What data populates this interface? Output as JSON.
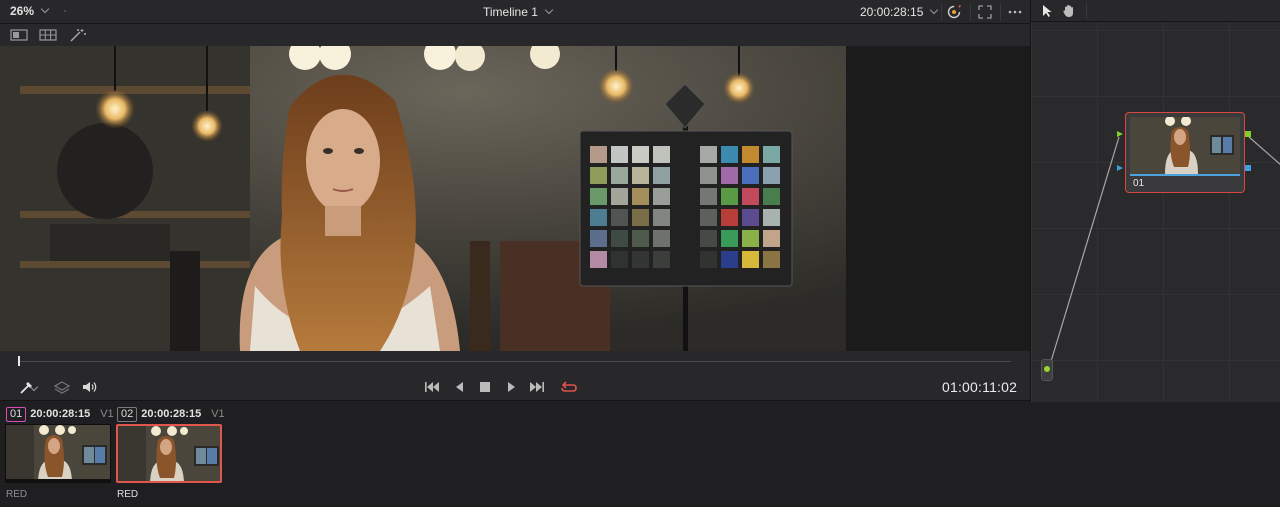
{
  "viewer": {
    "zoom_label": "26%",
    "timeline_title": "Timeline 1",
    "source_timecode": "20:00:28:15",
    "current_timecode": "01:00:11:02"
  },
  "clips": [
    {
      "number": "01",
      "timecode": "20:00:28:15",
      "track": "V1",
      "label": "RED",
      "selected": false
    },
    {
      "number": "02",
      "timecode": "20:00:28:15",
      "track": "V1",
      "label": "RED",
      "selected": true
    }
  ],
  "nodes": {
    "main_label": "01"
  },
  "colors": {
    "accent_red": "#e0574d",
    "loop_red": "#e0524a",
    "node_bar_blue": "#4aa3df",
    "port_green": "#7fd12a",
    "clip_badge_pink": "#d54fb5"
  },
  "icons": {
    "topbar": [
      "chevron-down-icon",
      "highlight-icon",
      "fullscreen-icon",
      "more-options-icon"
    ],
    "subbar": [
      "single-viewer-icon",
      "split-viewer-icon",
      "magic-wand-icon"
    ],
    "transport": [
      "color-picker-icon",
      "layers-icon",
      "volume-icon",
      "go-to-first-frame-icon",
      "play-reverse-icon",
      "stop-icon",
      "play-icon",
      "go-to-last-frame-icon",
      "loop-icon"
    ],
    "node_toolbar": [
      "pointer-icon",
      "hand-icon"
    ]
  }
}
